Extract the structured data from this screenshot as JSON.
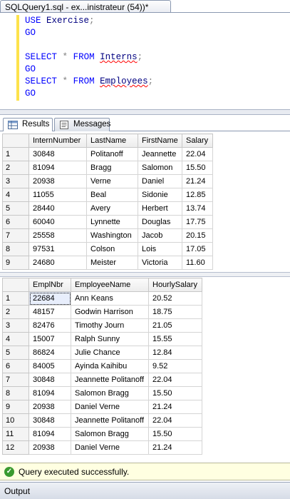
{
  "document_tab": {
    "title": "SQLQuery1.sql - ex...inistrateur (54))*"
  },
  "editor": {
    "lines": [
      {
        "kw": "USE",
        "id": "Exercise",
        "term": ";"
      },
      {
        "go": "GO"
      },
      {
        "blank": ""
      },
      {
        "kw": "SELECT",
        "star": "*",
        "from": "FROM",
        "table": "Interns",
        "term": ";"
      },
      {
        "go": "GO"
      },
      {
        "kw": "SELECT",
        "star": "*",
        "from": "FROM",
        "table": "Employees",
        "term": ";"
      },
      {
        "go": "GO"
      }
    ]
  },
  "result_tabs": {
    "results": "Results",
    "messages": "Messages"
  },
  "grid1": {
    "columns": [
      "InternNumber",
      "LastName",
      "FirstName",
      "Salary"
    ],
    "rows": [
      [
        "1",
        "30848",
        "Politanoff",
        "Jeannette",
        "22.04"
      ],
      [
        "2",
        "81094",
        "Bragg",
        "Salomon",
        "15.50"
      ],
      [
        "3",
        "20938",
        "Verne",
        "Daniel",
        "21.24"
      ],
      [
        "4",
        "11055",
        "Beal",
        "Sidonie",
        "12.85"
      ],
      [
        "5",
        "28440",
        "Avery",
        "Herbert",
        "13.74"
      ],
      [
        "6",
        "60040",
        "Lynnette",
        "Douglas",
        "17.75"
      ],
      [
        "7",
        "25558",
        "Washington",
        "Jacob",
        "20.15"
      ],
      [
        "8",
        "97531",
        "Colson",
        "Lois",
        "17.05"
      ],
      [
        "9",
        "24680",
        "Meister",
        "Victoria",
        "11.60"
      ]
    ]
  },
  "grid2": {
    "columns": [
      "EmplNbr",
      "EmployeeName",
      "HourlySalary"
    ],
    "rows": [
      [
        "1",
        "22684",
        "Ann Keans",
        "20.52"
      ],
      [
        "2",
        "48157",
        "Godwin Harrison",
        "18.75"
      ],
      [
        "3",
        "82476",
        "Timothy Journ",
        "21.05"
      ],
      [
        "4",
        "15007",
        "Ralph Sunny",
        "15.55"
      ],
      [
        "5",
        "86824",
        "Julie Chance",
        "12.84"
      ],
      [
        "6",
        "84005",
        "Ayinda Kaihibu",
        "9.52"
      ],
      [
        "7",
        "30848",
        "Jeannette Politanoff",
        "22.04"
      ],
      [
        "8",
        "81094",
        "Salomon Bragg",
        "15.50"
      ],
      [
        "9",
        "20938",
        "Daniel Verne",
        "21.24"
      ],
      [
        "10",
        "30848",
        "Jeannette Politanoff",
        "22.04"
      ],
      [
        "11",
        "81094",
        "Salomon Bragg",
        "15.50"
      ],
      [
        "12",
        "20938",
        "Daniel Verne",
        "21.24"
      ]
    ]
  },
  "status": {
    "message": "Query executed successfully.",
    "icon": "check-circle-icon",
    "color": "#ffffe1"
  },
  "output_panel": {
    "title": "Output"
  }
}
